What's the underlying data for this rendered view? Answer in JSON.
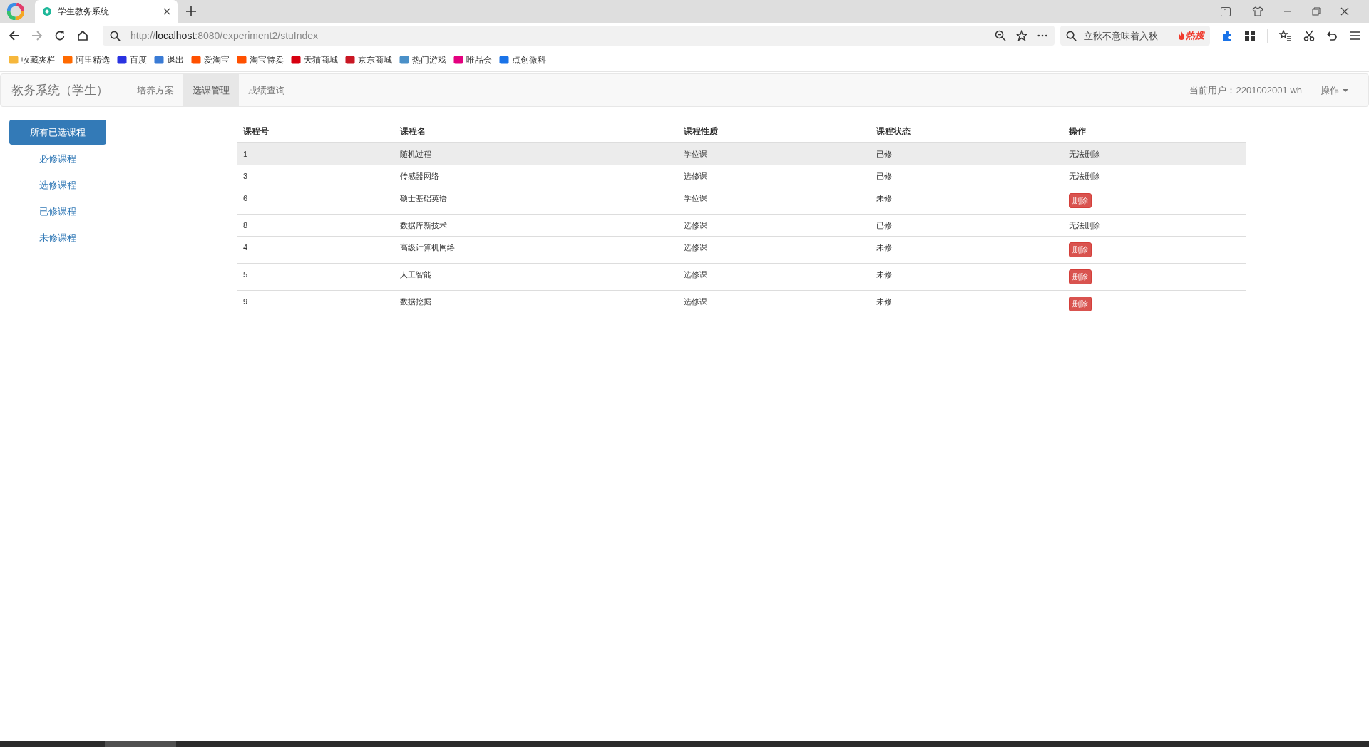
{
  "browser": {
    "tab_title": "学生教务系统",
    "tab_count": "1",
    "address": {
      "prefix": "http://",
      "host": "localhost",
      "rest": ":8080/experiment2/stuIndex"
    },
    "search": {
      "placeholder": "立秋不意味着入秋",
      "hot": "热搜"
    },
    "bookmarks": [
      {
        "label": "收藏夹栏",
        "color": "#f6b73c"
      },
      {
        "label": "阿里精选",
        "color": "#ff6a00"
      },
      {
        "label": "百度",
        "color": "#2932e1"
      },
      {
        "label": "退出",
        "color": "#3a7bd5"
      },
      {
        "label": "爱淘宝",
        "color": "#ff5000"
      },
      {
        "label": "淘宝特卖",
        "color": "#ff5000"
      },
      {
        "label": "天猫商城",
        "color": "#d70010"
      },
      {
        "label": "京东商城",
        "color": "#c91623"
      },
      {
        "label": "热门游戏",
        "color": "#4a90c8"
      },
      {
        "label": "唯品会",
        "color": "#e4007f"
      },
      {
        "label": "点创微科",
        "color": "#1a73e8"
      }
    ]
  },
  "navbar": {
    "brand": "教务系统（学生）",
    "items": [
      {
        "label": "培养方案",
        "selected": false
      },
      {
        "label": "选课管理",
        "selected": true
      },
      {
        "label": "成绩查询",
        "selected": false
      }
    ],
    "user": "当前用户：2201002001 wh",
    "menu": "操作"
  },
  "sidebar": {
    "items": [
      {
        "label": "所有已选课程",
        "selected": true
      },
      {
        "label": "必修课程",
        "selected": false
      },
      {
        "label": "选修课程",
        "selected": false
      },
      {
        "label": "已修课程",
        "selected": false
      },
      {
        "label": "未修课程",
        "selected": false
      }
    ]
  },
  "table": {
    "columns": [
      "课程号",
      "课程名",
      "课程性质",
      "课程状态",
      "操作"
    ],
    "rows": [
      {
        "id": "1",
        "name": "随机过程",
        "type": "学位课",
        "status": "已修",
        "action": {
          "kind": "text",
          "label": "无法删除"
        },
        "selected": true
      },
      {
        "id": "3",
        "name": "传感器网络",
        "type": "选修课",
        "status": "已修",
        "action": {
          "kind": "text",
          "label": "无法删除"
        },
        "selected": false
      },
      {
        "id": "6",
        "name": "硕士基础英语",
        "type": "学位课",
        "status": "未修",
        "action": {
          "kind": "button",
          "label": "删除"
        },
        "selected": false
      },
      {
        "id": "8",
        "name": "数据库新技术",
        "type": "选修课",
        "status": "已修",
        "action": {
          "kind": "text",
          "label": "无法删除"
        },
        "selected": false
      },
      {
        "id": "4",
        "name": "高级计算机网络",
        "type": "选修课",
        "status": "未修",
        "action": {
          "kind": "button",
          "label": "删除"
        },
        "selected": false
      },
      {
        "id": "5",
        "name": "人工智能",
        "type": "选修课",
        "status": "未修",
        "action": {
          "kind": "button",
          "label": "删除"
        },
        "selected": false
      },
      {
        "id": "9",
        "name": "数据挖掘",
        "type": "选修课",
        "status": "未修",
        "action": {
          "kind": "button",
          "label": "删除"
        },
        "selected": false
      }
    ]
  }
}
